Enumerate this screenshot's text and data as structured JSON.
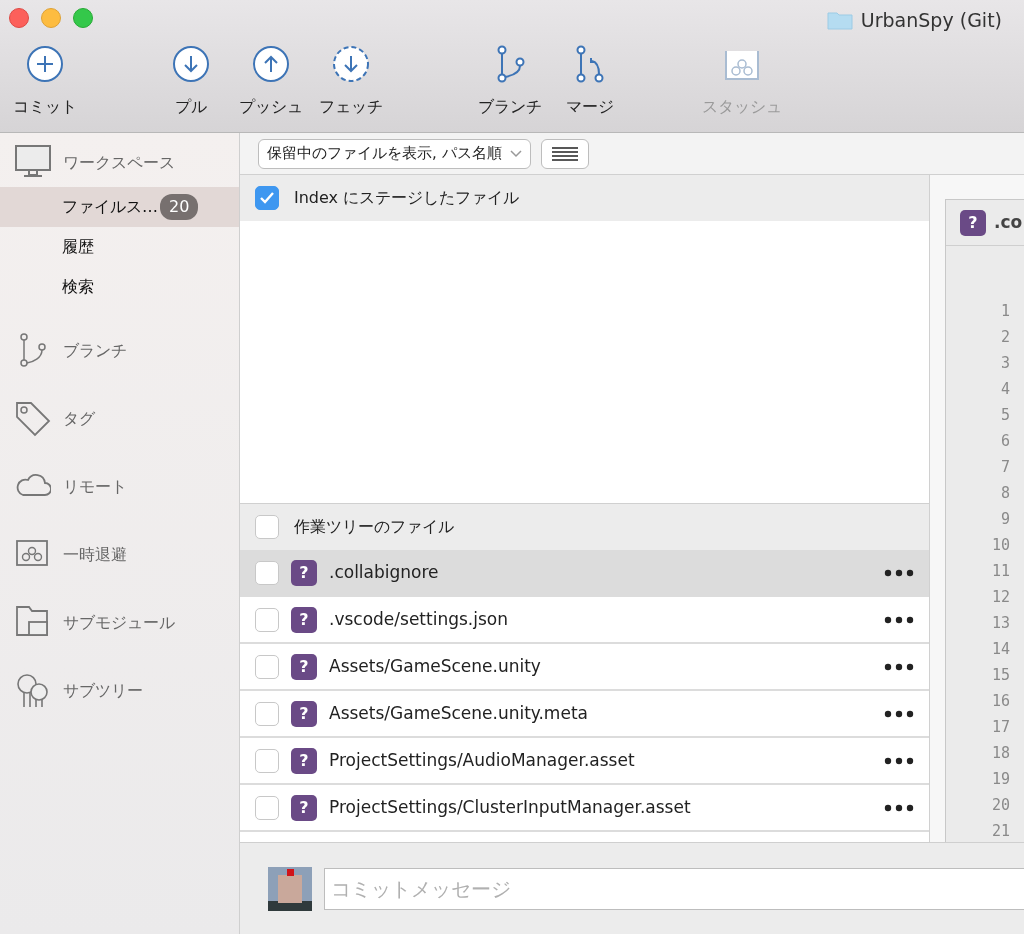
{
  "window": {
    "title": "UrbanSpy (Git)"
  },
  "toolbar": [
    [
      {
        "label": "コミット",
        "kind": "commit",
        "disabled": false
      }
    ],
    [
      {
        "label": "プル",
        "kind": "pull",
        "disabled": false
      },
      {
        "label": "プッシュ",
        "kind": "push",
        "disabled": false
      },
      {
        "label": "フェッチ",
        "kind": "fetch",
        "disabled": false
      }
    ],
    [
      {
        "label": "ブランチ",
        "kind": "branch",
        "disabled": false
      },
      {
        "label": "マージ",
        "kind": "merge",
        "disabled": false
      }
    ],
    [
      {
        "label": "スタッシュ",
        "kind": "stash",
        "disabled": true
      }
    ]
  ],
  "sidebar": {
    "sections": [
      {
        "label": "ワークスペース",
        "kind": "workspace",
        "children": [
          {
            "label": "ファイルス…",
            "badge": "20",
            "selected": true
          },
          {
            "label": "履歴",
            "selected": false
          },
          {
            "label": "検索",
            "selected": false
          }
        ]
      },
      {
        "label": "ブランチ",
        "kind": "branch"
      },
      {
        "label": "タグ",
        "kind": "tag"
      },
      {
        "label": "リモート",
        "kind": "remote"
      },
      {
        "label": "一時退避",
        "kind": "stash"
      },
      {
        "label": "サブモジュール",
        "kind": "submodule"
      },
      {
        "label": "サブツリー",
        "kind": "subtree"
      }
    ]
  },
  "filter": {
    "value": "保留中のファイルを表示, パス名順"
  },
  "staged": {
    "label": "Index にステージしたファイル",
    "checked": true
  },
  "working": {
    "label": "作業ツリーのファイル",
    "checked": false,
    "files": [
      {
        "status": "?",
        "name": ".collabignore",
        "checked": false,
        "selected": true
      },
      {
        "status": "?",
        "name": ".vscode/settings.json",
        "checked": false,
        "selected": false
      },
      {
        "status": "?",
        "name": "Assets/GameScene.unity",
        "checked": false,
        "selected": false
      },
      {
        "status": "?",
        "name": "Assets/GameScene.unity.meta",
        "checked": false,
        "selected": false
      },
      {
        "status": "?",
        "name": "ProjectSettings/AudioManager.asset",
        "checked": false,
        "selected": false
      },
      {
        "status": "?",
        "name": "ProjectSettings/ClusterInputManager.asset",
        "checked": false,
        "selected": false
      }
    ]
  },
  "diff": {
    "status": "?",
    "file": ".co",
    "line_numbers": [
      "1",
      "2",
      "3",
      "4",
      "5",
      "6",
      "7",
      "8",
      "9",
      "10",
      "11",
      "12",
      "13",
      "14",
      "15",
      "16",
      "17",
      "18",
      "19",
      "20",
      "21"
    ]
  },
  "commit": {
    "placeholder": "コミットメッセージ"
  }
}
